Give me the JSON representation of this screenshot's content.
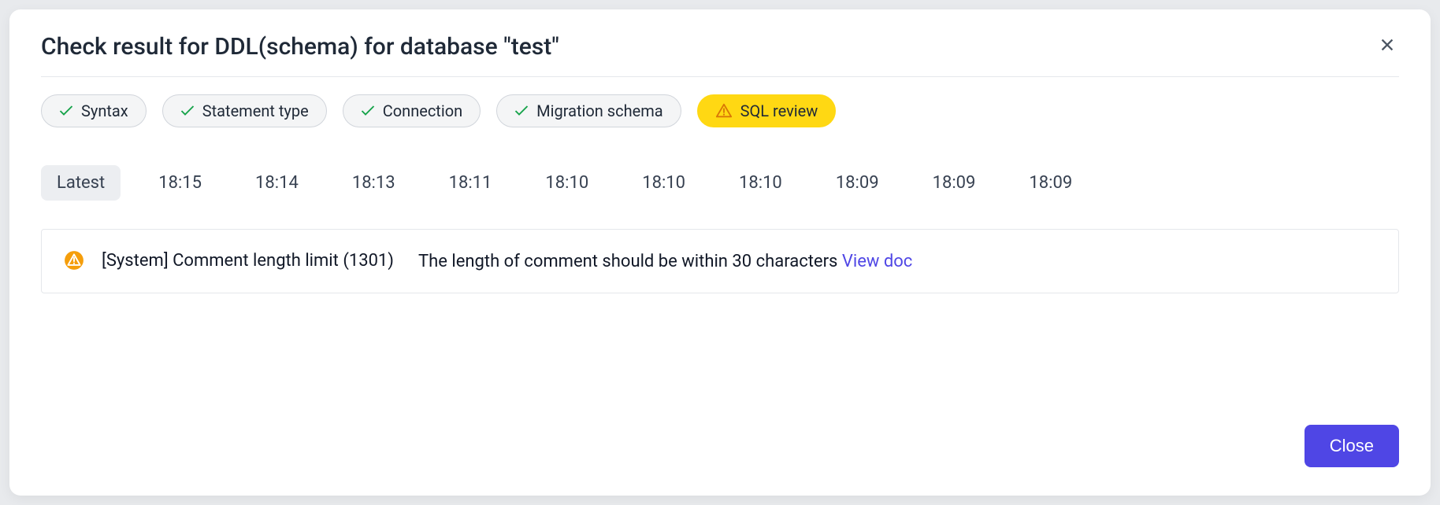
{
  "modal": {
    "title": "Check result for DDL(schema) for database \"test\"",
    "close_label": "Close"
  },
  "checks": [
    {
      "label": "Syntax",
      "status": "ok"
    },
    {
      "label": "Statement type",
      "status": "ok"
    },
    {
      "label": "Connection",
      "status": "ok"
    },
    {
      "label": "Migration schema",
      "status": "ok"
    },
    {
      "label": "SQL review",
      "status": "warning"
    }
  ],
  "run_tabs": [
    "Latest",
    "18:15",
    "18:14",
    "18:13",
    "18:11",
    "18:10",
    "18:10",
    "18:10",
    "18:09",
    "18:09",
    "18:09"
  ],
  "result": {
    "title": "[System] Comment length limit (1301)",
    "description": "The length of comment should be within 30 characters ",
    "link_label": "View doc"
  }
}
